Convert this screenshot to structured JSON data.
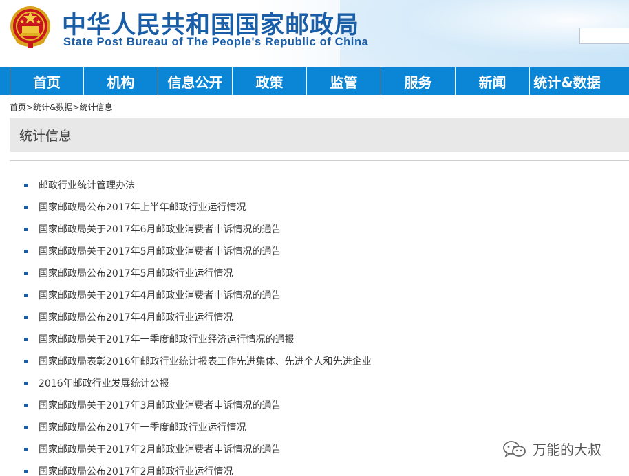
{
  "header": {
    "title_cn": "中华人民共和国国家邮政局",
    "title_en": "State Post Bureau of The People's Republic of China",
    "search_placeholder": "",
    "brand_color": "#1b5ea8"
  },
  "nav": {
    "items": [
      "首页",
      "机构",
      "信息公开",
      "政策",
      "监管",
      "服务",
      "新闻",
      "统计&数据"
    ],
    "background": "#0b86d6"
  },
  "breadcrumb": {
    "items": [
      "首页",
      "统计&数据",
      "统计信息"
    ],
    "separator": ">"
  },
  "section": {
    "title": "统计信息"
  },
  "list": {
    "items": [
      "邮政行业统计管理办法",
      "国家邮政局公布2017年上半年邮政行业运行情况",
      "国家邮政局关于2017年6月邮政业消费者申诉情况的通告",
      "国家邮政局关于2017年5月邮政业消费者申诉情况的通告",
      "国家邮政局公布2017年5月邮政行业运行情况",
      "国家邮政局关于2017年4月邮政业消费者申诉情况的通告",
      "国家邮政局公布2017年4月邮政行业运行情况",
      "国家邮政局关于2017年一季度邮政行业经济运行情况的通报",
      "国家邮政局表彰2016年邮政行业统计报表工作先进集体、先进个人和先进企业",
      "2016年邮政行业发展统计公报",
      "国家邮政局关于2017年3月邮政业消费者申诉情况的通告",
      "国家邮政局公布2017年一季度邮政行业运行情况",
      "国家邮政局关于2017年2月邮政业消费者申诉情况的通告",
      "国家邮政局公布2017年2月邮政行业运行情况"
    ]
  },
  "watermark": {
    "text": "万能的大叔",
    "icon": "wechat-icon"
  }
}
